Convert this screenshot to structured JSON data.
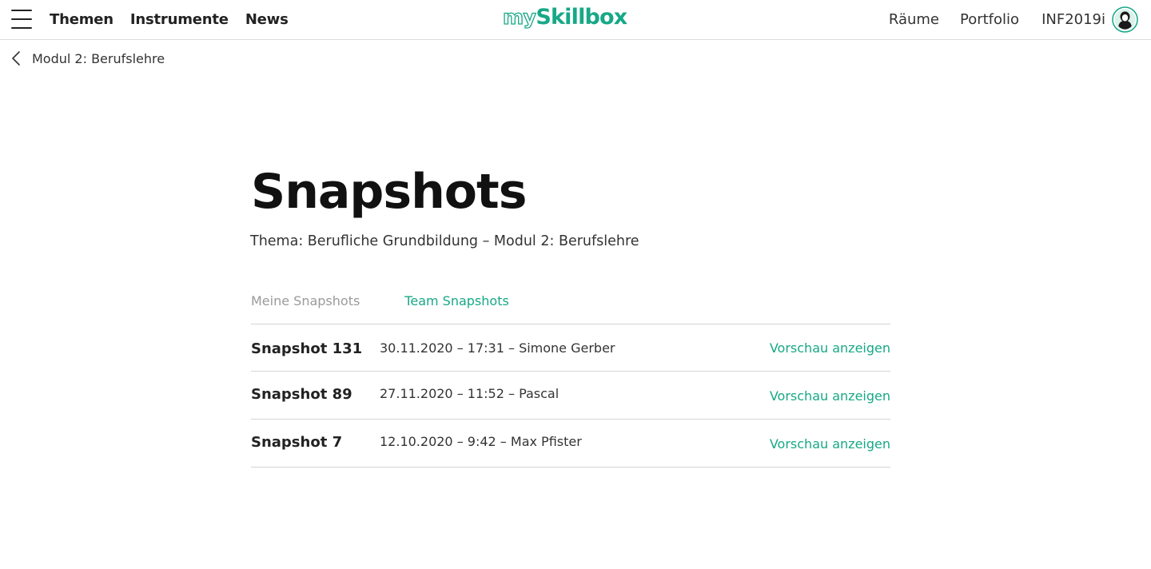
{
  "header": {
    "nav_left": [
      "Themen",
      "Instrumente",
      "News"
    ],
    "logo": {
      "prefix": "my",
      "name": "Skillbox"
    },
    "nav_right": [
      "Räume",
      "Portfolio"
    ],
    "class_name": "INF2019i",
    "icons": {
      "menu": "hamburger-menu-icon",
      "avatar": "user-avatar-icon"
    }
  },
  "breadcrumb": {
    "label": "Modul 2: Berufslehre",
    "icon": "chevron-left-icon"
  },
  "page": {
    "title": "Snapshots",
    "subtitle": "Thema: Berufliche Grundbildung – Modul 2: Berufslehre"
  },
  "tabs": [
    {
      "label": "Meine Snapshots",
      "active": false
    },
    {
      "label": "Team Snapshots",
      "active": true
    }
  ],
  "snapshots": [
    {
      "title": "Snapshot 131",
      "meta": "30.11.2020 – 17:31 – Simone Gerber",
      "action": "Vorschau anzeigen"
    },
    {
      "title": "Snapshot 89",
      "meta": "27.11.2020 – 11:52 – Pascal",
      "action": "Vorschau anzeigen"
    },
    {
      "title": "Snapshot 7",
      "meta": "12.10.2020 – 9:42 – Max Pfister",
      "action": "Vorschau anzeigen"
    }
  ],
  "colors": {
    "accent": "#17a887",
    "text": "#222222",
    "muted": "#9a9a9a",
    "divider": "#d4d4d4"
  }
}
